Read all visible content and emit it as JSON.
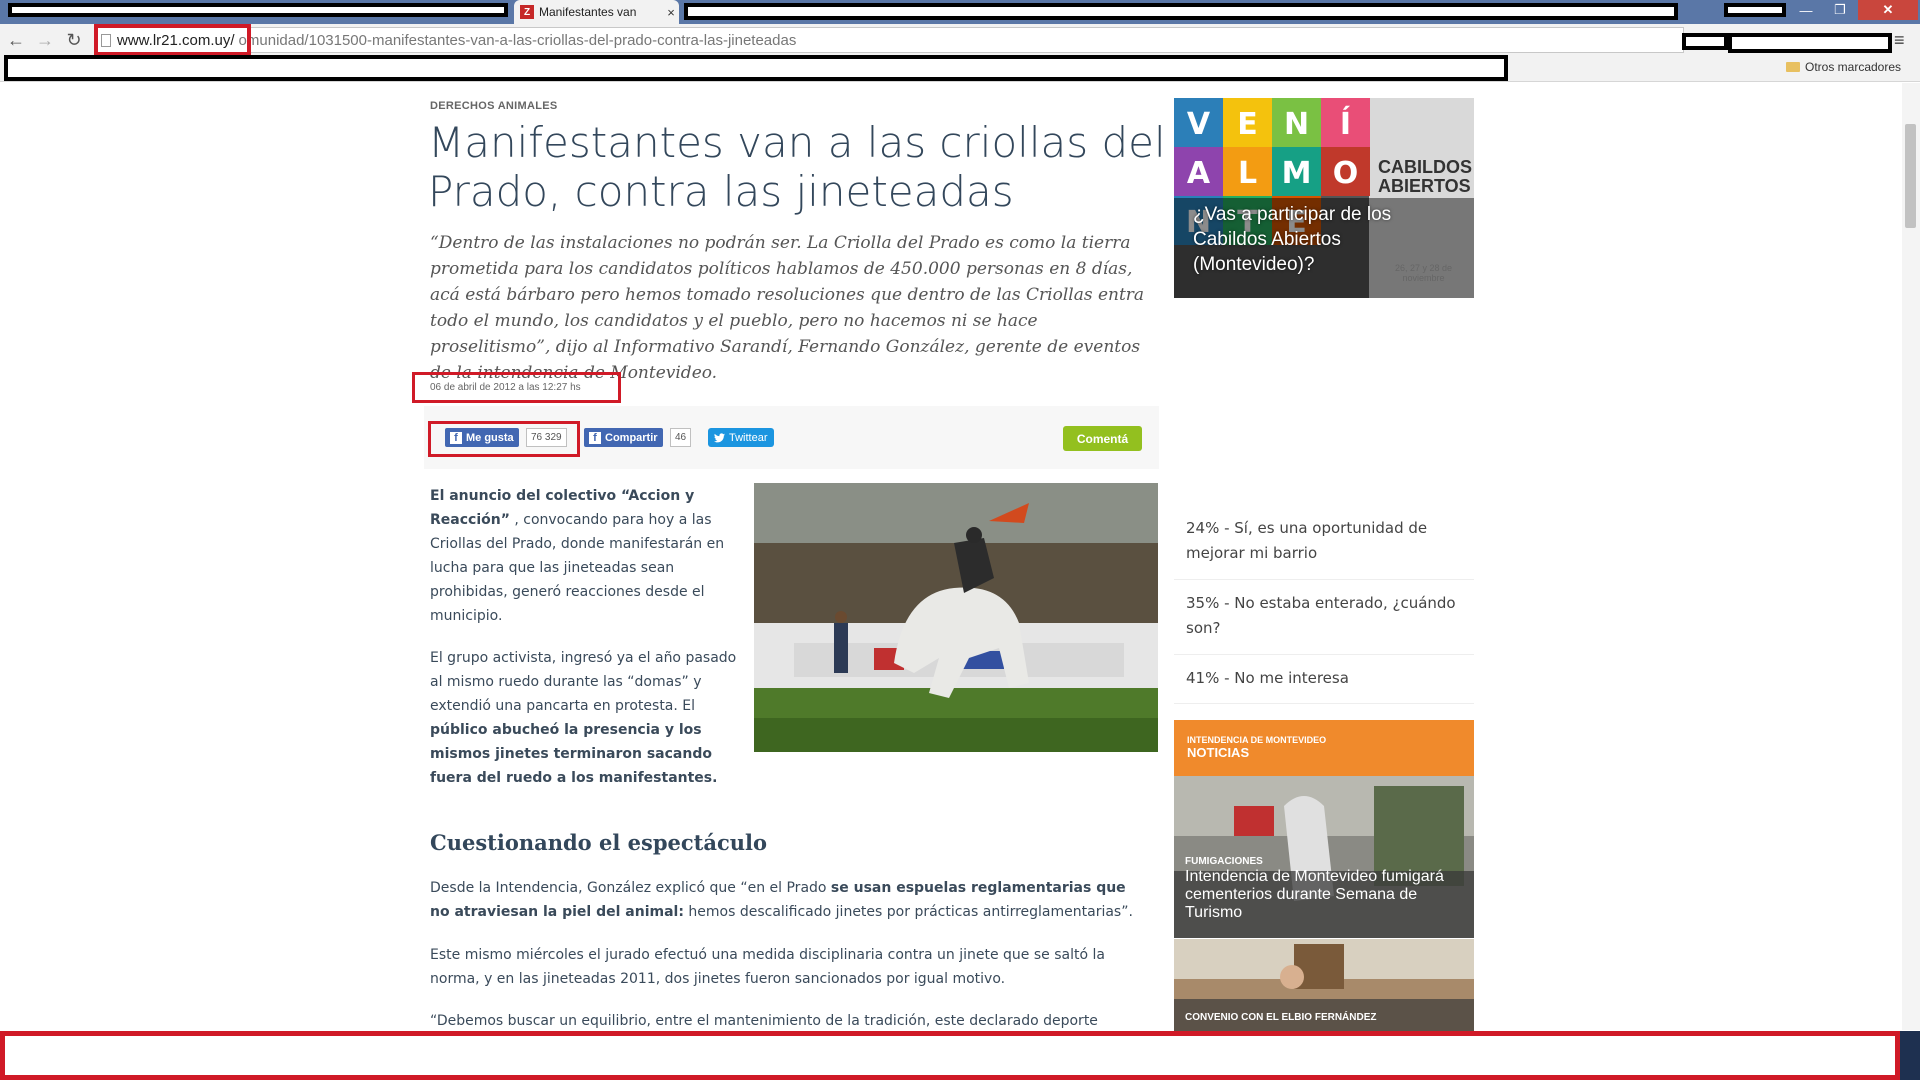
{
  "browser": {
    "active_tab_title": "Manifestantes van",
    "tab_close": "×",
    "url_host": "www.lr21.com.uy/",
    "url_path": "omunidad/1031500-manifestantes-van-a-las-criollas-del-prado-contra-las-jineteadas",
    "other_bookmarks": "Otros marcadores",
    "win_close": "✕",
    "win_min": "—",
    "win_max": "❐",
    "nav_back": "←",
    "nav_forward": "→",
    "nav_reload": "↻",
    "menu": "≡"
  },
  "article": {
    "section": "DERECHOS ANIMALES",
    "headline": "Manifestantes van a las criollas del Prado, contra las jineteadas",
    "lead": "“Dentro de las instalaciones no podrán ser. La Criolla del Prado es como la tierra prometida para los candidatos políticos hablamos de 450.000 personas en 8 días, acá está bárbaro pero hemos tomado resoluciones que dentro de las Criollas entra todo el mundo, los candidatos y el pueblo, pero no hacemos ni se hace proselitismo”, dijo al Informativo Sarandí, Fernando González, gerente de eventos de la intendencia de Montevideo.",
    "date": "06 de abril de 2012 a las 12:27 hs",
    "p1_bold": "El anuncio del colectivo “Accion y Reacción”",
    "p1_rest": " , convocando para hoy a las Criollas del Prado, donde manifestarán en lucha para que las jineteadas sean prohibidas, generó reacciones desde el municipio.",
    "p2_start": "El grupo activista, ingresó ya el año pasado al mismo ruedo durante las “domas” y extendió una pancarta en protesta. El ",
    "p2_bold": "público abucheó la presencia y los mismos jinetes terminaron sacando fuera del ruedo a los manifestantes.",
    "subhead": "Cuestionando el espectáculo",
    "p3_start": "Desde la Intendencia, González explicó que “en el Prado ",
    "p3_bold": "se usan espuelas reglamentarias que no atraviesan la piel del animal:",
    "p3_end": " hemos descalificado jinetes por prácticas antirreglamentarias”.",
    "p4": "Este mismo miércoles el jurado efectuó una medida disciplinaria contra un jinete que se saltó la norma, y en las jineteadas 2011, dos jinetes fueron sancionados por igual motivo.",
    "p5": "“Debemos buscar un equilibrio, entre el mantenimiento de la tradición, este declarado deporte"
  },
  "share": {
    "like_label": "Me gusta",
    "like_count": "76 329",
    "share_label": "Compartir",
    "share_count": "46",
    "tweet_label": "Twittear",
    "comment_label": "Comentá"
  },
  "sidebar": {
    "ad_title": "¿Vas a participar de los Cabildos Abiertos (Montevideo)?",
    "ad_badge": "CABILDOS ABIERTOS",
    "ad_letters": [
      "V",
      "E",
      "N",
      "Í",
      "A",
      "L",
      "M",
      "O",
      "N",
      "T",
      "E"
    ],
    "ad_dates": "26, 27 y 28 de noviembre",
    "poll": [
      "24% - Sí, es una oportunidad de mejorar mi barrio",
      "35% - No estaba enterado, ¿cuándo son?",
      "41% - No me interesa"
    ],
    "news_kicker": "INTENDENCIA DE MONTEVIDEO",
    "news_title": "NOTICIAS",
    "news": [
      {
        "kicker": "FUMIGACIONES",
        "title": "Intendencia de Montevideo fumigará cementerios durante Semana de Turismo"
      },
      {
        "kicker": "CONVENIO CON EL ELBIO FERNÁNDEZ",
        "title": ""
      }
    ]
  }
}
